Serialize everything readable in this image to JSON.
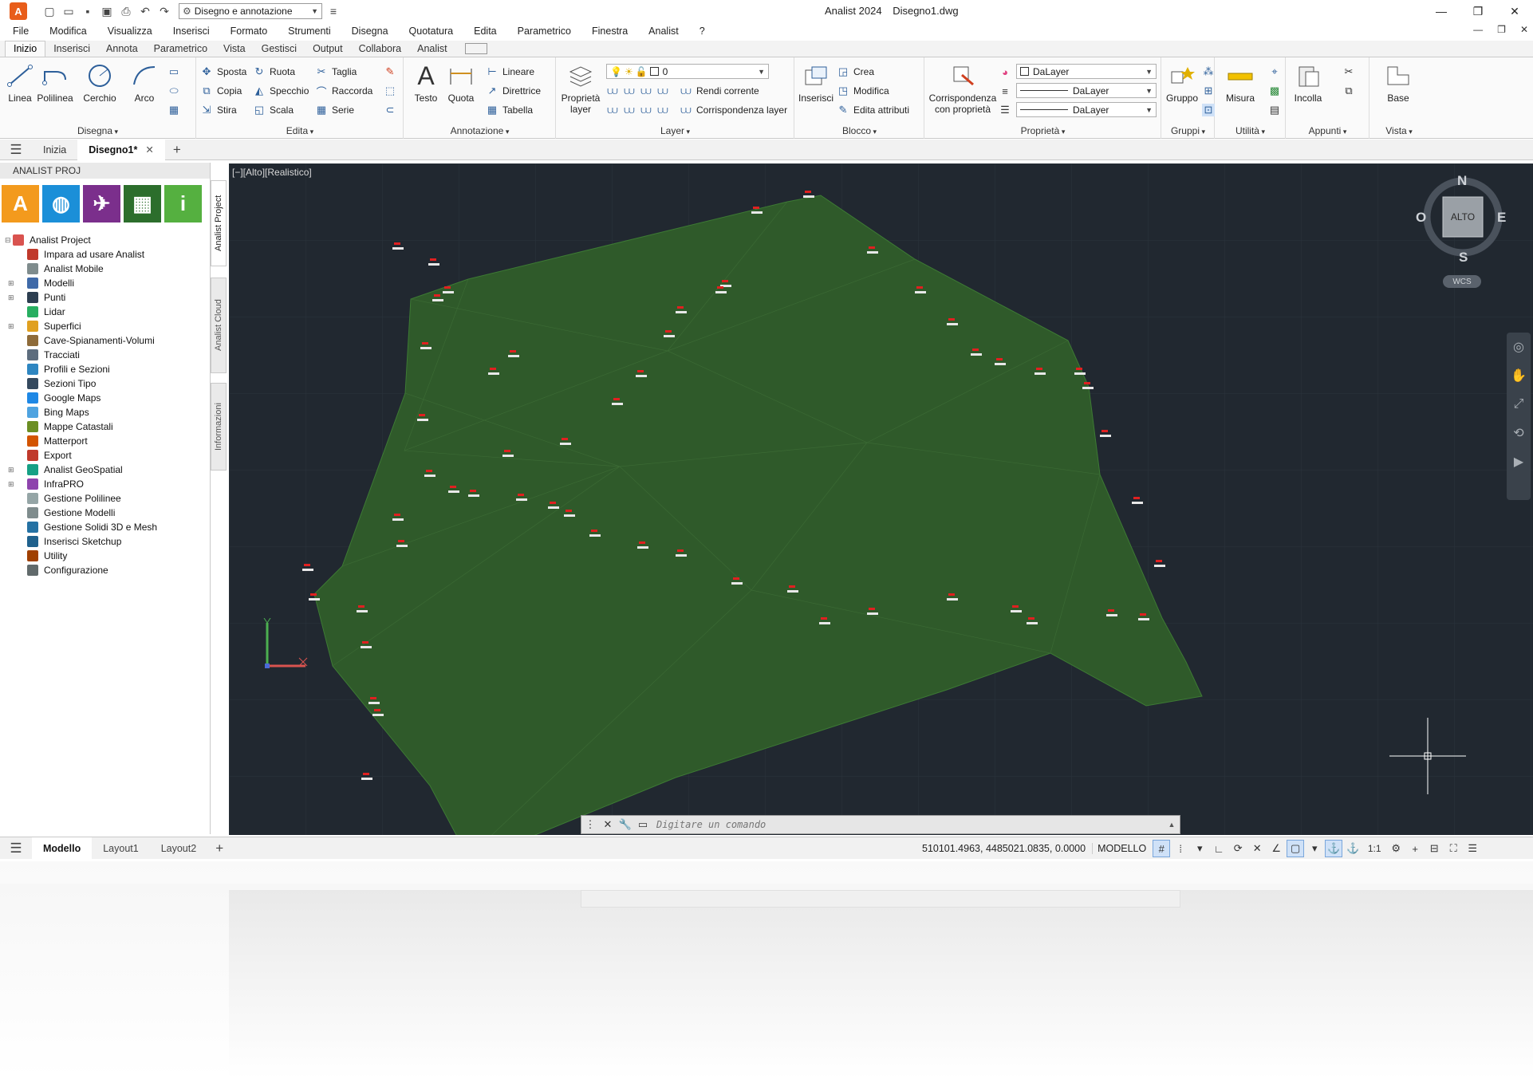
{
  "window": {
    "app_title": "Analist 2024",
    "doc_title": "Disegno1.dwg",
    "workspace": "Disegno e annotazione"
  },
  "menu": [
    "File",
    "Modifica",
    "Visualizza",
    "Inserisci",
    "Formato",
    "Strumenti",
    "Disegna",
    "Quotatura",
    "Edita",
    "Parametrico",
    "Finestra",
    "Analist",
    "?"
  ],
  "ribbon_tabs": [
    "Inizio",
    "Inserisci",
    "Annota",
    "Parametrico",
    "Vista",
    "Gestisci",
    "Output",
    "Collabora",
    "Analist"
  ],
  "ribbon": {
    "disegna": {
      "title": "Disegna",
      "linea": "Linea",
      "polilinea": "Polilinea",
      "cerchio": "Cerchio",
      "arco": "Arco"
    },
    "edita": {
      "title": "Edita",
      "sposta": "Sposta",
      "ruota": "Ruota",
      "taglia": "Taglia",
      "copia": "Copia",
      "specchio": "Specchio",
      "raccorda": "Raccorda",
      "stira": "Stira",
      "scala": "Scala",
      "serie": "Serie"
    },
    "annotazione": {
      "title": "Annotazione",
      "testo": "Testo",
      "quota": "Quota",
      "lineare": "Lineare",
      "direttrice": "Direttrice",
      "tabella": "Tabella"
    },
    "layer": {
      "title": "Layer",
      "proprieta_layer": "Proprietà layer",
      "layer_value": "0",
      "rendi_corrente": "Rendi corrente",
      "corrispondenza_layer": "Corrispondenza layer"
    },
    "blocco": {
      "title": "Blocco",
      "inserisci": "Inserisci",
      "crea": "Crea",
      "modifica": "Modifica",
      "edita_attributi": "Edita attributi"
    },
    "proprieta": {
      "title": "Proprietà",
      "corrispondenza": "Corrispondenza con proprietà",
      "color": "DaLayer",
      "linetype": "DaLayer",
      "lineweight": "DaLayer"
    },
    "gruppi": {
      "title": "Gruppi",
      "gruppo": "Gruppo"
    },
    "utilita": {
      "title": "Utilità",
      "misura": "Misura"
    },
    "appunti": {
      "title": "Appunti",
      "incolla": "Incolla"
    },
    "vista": {
      "title": "Vista",
      "base": "Base"
    }
  },
  "doc_tabs": {
    "start": "Inizia",
    "active": "Disegno1*"
  },
  "palette": {
    "header": "ANALIST PROJ",
    "side_tabs": [
      "Analist Project",
      "Analist Cloud",
      "Informazioni"
    ],
    "tree_root": "Analist Project",
    "tree": [
      {
        "label": "Impara ad usare Analist",
        "color": "#c0392b"
      },
      {
        "label": "Analist Mobile",
        "color": "#7f8c8d"
      },
      {
        "label": "Modelli",
        "color": "#3f6aa8"
      },
      {
        "label": "Punti",
        "color": "#2c3e50"
      },
      {
        "label": "Lidar",
        "color": "#27ae60"
      },
      {
        "label": "Superfici",
        "color": "#e0a020"
      },
      {
        "label": "Cave-Spianamenti-Volumi",
        "color": "#8e6b3a"
      },
      {
        "label": "Tracciati",
        "color": "#5d6d7e"
      },
      {
        "label": "Profili e Sezioni",
        "color": "#2e86c1"
      },
      {
        "label": "Sezioni Tipo",
        "color": "#34495e"
      },
      {
        "label": "Google Maps",
        "color": "#1e88e5"
      },
      {
        "label": "Bing Maps",
        "color": "#4fa3e0"
      },
      {
        "label": "Mappe Catastali",
        "color": "#6b8e23"
      },
      {
        "label": "Matterport",
        "color": "#d35400"
      },
      {
        "label": "Export",
        "color": "#c0392b"
      },
      {
        "label": "Analist GeoSpatial",
        "color": "#16a085"
      },
      {
        "label": "InfraPRO",
        "color": "#8e44ad"
      },
      {
        "label": "Gestione Polilinee",
        "color": "#95a5a6"
      },
      {
        "label": "Gestione Modelli",
        "color": "#7f8c8d"
      },
      {
        "label": "Gestione Solidi 3D e Mesh",
        "color": "#2471a3"
      },
      {
        "label": "Inserisci Sketchup",
        "color": "#1f618d"
      },
      {
        "label": "Utility",
        "color": "#a04000"
      },
      {
        "label": "Configurazione",
        "color": "#616a6b"
      }
    ]
  },
  "viewport": {
    "label": "[−][Alto][Realistico]",
    "cube_top": "ALTO",
    "cube_n": "N",
    "cube_s": "S",
    "cube_e": "E",
    "cube_o": "O",
    "ucs": "WCS"
  },
  "command": {
    "placeholder": "Digitare un comando"
  },
  "status": {
    "layouts": [
      "Modello",
      "Layout1",
      "Layout2"
    ],
    "coords": "510101.4963, 4485021.0835, 0.0000",
    "space": "MODELLO",
    "scale": "1:1"
  }
}
